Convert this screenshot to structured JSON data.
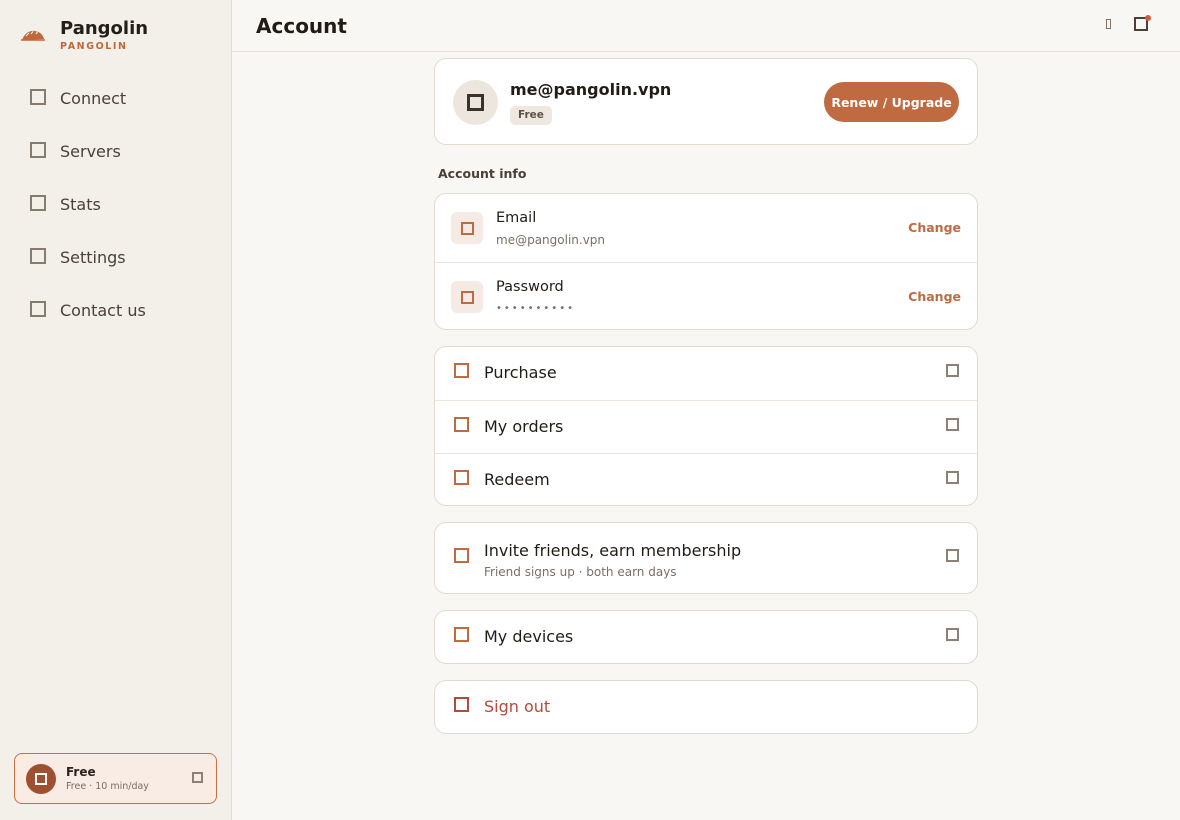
{
  "brand": {
    "name": "Pangolin",
    "subtitle": "PANGOLIN"
  },
  "sidebar": {
    "items": [
      {
        "label": "Connect",
        "icon": "connect-icon"
      },
      {
        "label": "Servers",
        "icon": "servers-icon"
      },
      {
        "label": "Stats",
        "icon": "stats-icon"
      },
      {
        "label": "Settings",
        "icon": "settings-icon"
      },
      {
        "label": "Contact us",
        "icon": "contact-icon"
      }
    ],
    "plan": {
      "title": "Free",
      "subtitle": "Free · 10 min/day"
    }
  },
  "header": {
    "title": "Account",
    "glyph": "▯"
  },
  "profile": {
    "email": "me@pangolin.vpn",
    "tier": "Free",
    "upgrade_label": "Renew / Upgrade"
  },
  "account_info": {
    "section_label": "Account info",
    "email_label": "Email",
    "email_value": "me@pangolin.vpn",
    "password_label": "Password",
    "password_value": "••••••••••",
    "change_label": "Change"
  },
  "actions": {
    "purchase": "Purchase",
    "orders": "My orders",
    "redeem": "Redeem"
  },
  "invite": {
    "title": "Invite friends, earn membership",
    "subtitle": "Friend signs up · both earn days"
  },
  "devices": {
    "label": "My devices"
  },
  "signout": {
    "label": "Sign out"
  },
  "colors": {
    "accent": "#bf6a40",
    "danger": "#b6493c",
    "sidebar_bg": "#f3efe9",
    "page_bg": "#f9f7f3"
  }
}
